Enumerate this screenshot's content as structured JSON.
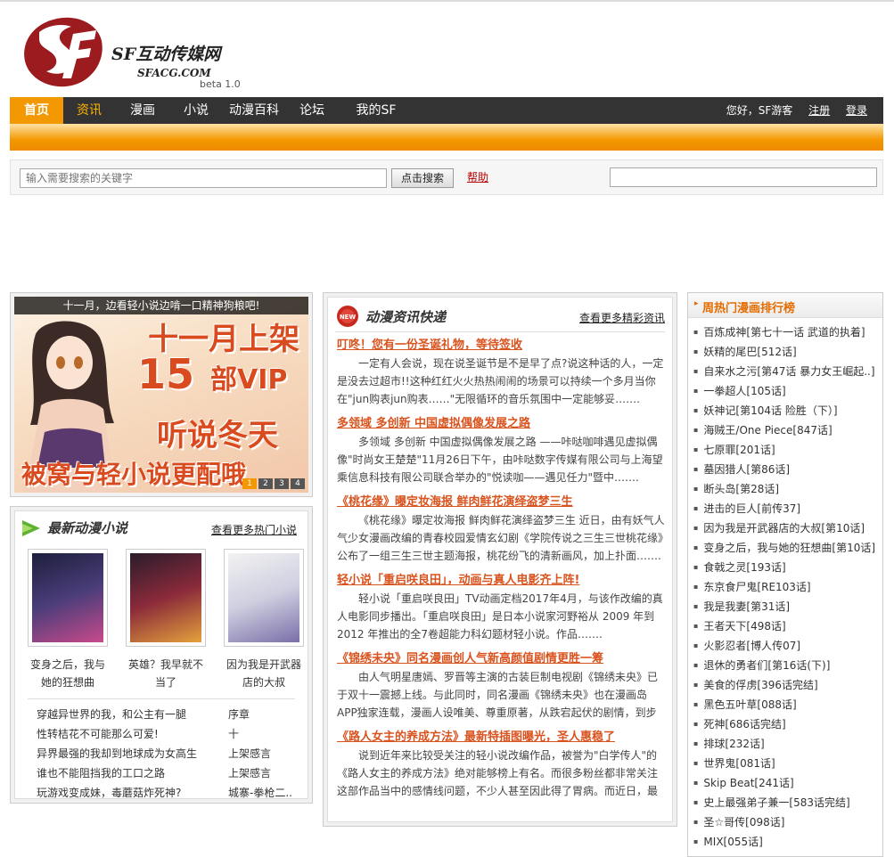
{
  "header": {
    "site_name": "SF互动传媒网",
    "domain": "SFACG.COM",
    "version": "beta 1.0",
    "logo_letters": "SF"
  },
  "nav": {
    "items": [
      {
        "label": "首页"
      },
      {
        "label": "资讯"
      },
      {
        "label": "漫画"
      },
      {
        "label": "小说"
      },
      {
        "label": "动漫百科"
      },
      {
        "label": "论坛"
      },
      {
        "label": "我的SF"
      }
    ],
    "greeting": "您好，SF游客",
    "register": "注册",
    "login": "登录"
  },
  "search": {
    "placeholder": "输入需要搜索的关键字",
    "button": "点击搜索",
    "help": "帮助"
  },
  "banner": {
    "caption": "十一月，边看轻小说边啃一口精神狗粮吧!",
    "line1": "十一月上架",
    "line2": "15",
    "line3": "部VIP",
    "line4": "听说冬天",
    "line5": "被窝与轻小说更配哦",
    "pages": [
      "1",
      "2",
      "3",
      "4"
    ]
  },
  "novels": {
    "title": "最新动漫小说",
    "more": "查看更多热门小说",
    "books": [
      {
        "name": "变身之后，我与她的狂想曲"
      },
      {
        "name": "英雄？我早就不当了"
      },
      {
        "name": "因为我是开武器店的大叔"
      }
    ],
    "list": [
      {
        "title": "穿越异世界的我，和公主有一腿",
        "chapter": "序章"
      },
      {
        "title": "性转桔花不可能那么可爱!",
        "chapter": "十"
      },
      {
        "title": "异界最强的我却到地球成为女高生",
        "chapter": "上架感言"
      },
      {
        "title": "谁也不能阻挡我的工口之路",
        "chapter": "上架感言"
      },
      {
        "title": "玩游戏变成妹，毒蘑菇炸死神?",
        "chapter": "城寨-拳枪二.."
      }
    ]
  },
  "news": {
    "title": "动漫资讯快递",
    "more": "查看更多精彩资讯",
    "items": [
      {
        "headline": "叮咚！您有一份圣诞礼物，等待签收",
        "body": "一定有人会说，现在说圣诞节是不是早了点?说这种话的人，一定是没去过超市!!这种红红火火热热闹闹的场景可以持续一个多月当你在\"jun购表jun购表……\"无限循环的音乐氛围中一定能够妥……."
      },
      {
        "headline": "多领域 多创新 中国虚拟偶像发展之路",
        "body": "多领域 多创新 中国虚拟偶像发展之路 ——咔哒咖啡遇见虚拟偶像\"时尚女王楚楚\"11月26日下午，由咔哒数字传媒有限公司与上海望乘信息科技有限公司联合举办的\"悦读咖——遇见任力\"暨中……."
      },
      {
        "headline": "《桃花缘》曝定妆海报 鲜肉鲜花演绎盗梦三生",
        "body": "《桃花缘》曝定妆海报 鲜肉鲜花演绎盗梦三生 近日，由有妖气人气少女漫画改编的青春校园爱情玄幻剧《学院传说之三生三世桃花缘》公布了一组三生三世主题海报，桃花纷飞的清新画风，加上扑面……."
      },
      {
        "headline": "轻小说「重启咲良田」，动画与真人电影齐上阵!",
        "body": "轻小说「重启咲良田」TV动画定档2017年4月，与该作改编的真人电影同步播出。「重启咲良田」是日本小说家河野裕从 2009 年到 2012 年推出的全7卷超能力科幻题材轻小说。作品……."
      },
      {
        "headline": "《锦绣未央》同名漫画创人气新高颜值剧情更胜一筹",
        "body": "由人气明星唐嫣、罗晋等主演的古装巨制电视剧《锦绣未央》已于双十一震撼上线。与此同时，同名漫画《锦绣未央》也在漫画岛APP独家连载，漫画人设唯美、尊重原著，从跌宕起伏的剧情，到步步为……."
      },
      {
        "headline": "《路人女主的养成方法》最新特插图曝光，圣人惠稳了",
        "body": "说到近年来比较受关注的轻小说改编作品，被誉为\"白学传人\"的《路人女主的养成方法》绝对能够榜上有名。而很多粉丝都非常关注这部作品当中的感情线问题，不少人甚至因此得了胃病。而近日，最新……."
      }
    ]
  },
  "ranking": {
    "title": "周热门漫画排行榜",
    "items": [
      "百炼成神[第七十一话 武道的执着]",
      "妖精的尾巴[512话]",
      "自来水之污[第47话 暴力女王崛起..]",
      "一拳超人[105话]",
      "妖神记[第104话 险胜（下）]",
      "海贼王/One Piece[847话]",
      "七原罪[201话]",
      "墓因猎人[第86话]",
      "断头岛[第28话]",
      "进击的巨人[前传37]",
      "因为我是开武器店的大叔[第10话]",
      "变身之后，我与她的狂想曲[第10话]",
      "食戟之灵[193话]",
      "东京食尸鬼[RE103话]",
      "我是我妻[第31话]",
      "王者天下[498话]",
      "火影忍者[博人传07]",
      "退休的勇者们[第16话(下)]",
      "美食的俘虏[396话完结]",
      "黑色五叶草[088话]",
      "死神[686话完结]",
      "排球[232话]",
      "世界鬼[081话]",
      "Skip Beat[241话]",
      "史上最强弟子兼一[583话完结]",
      "圣☆哥传[098话]",
      "MIX[055话]"
    ]
  },
  "colors": {
    "accent": "#f39800",
    "nav_bg": "#333333",
    "headline": "#d9531e",
    "rank_title": "#e56b00"
  }
}
